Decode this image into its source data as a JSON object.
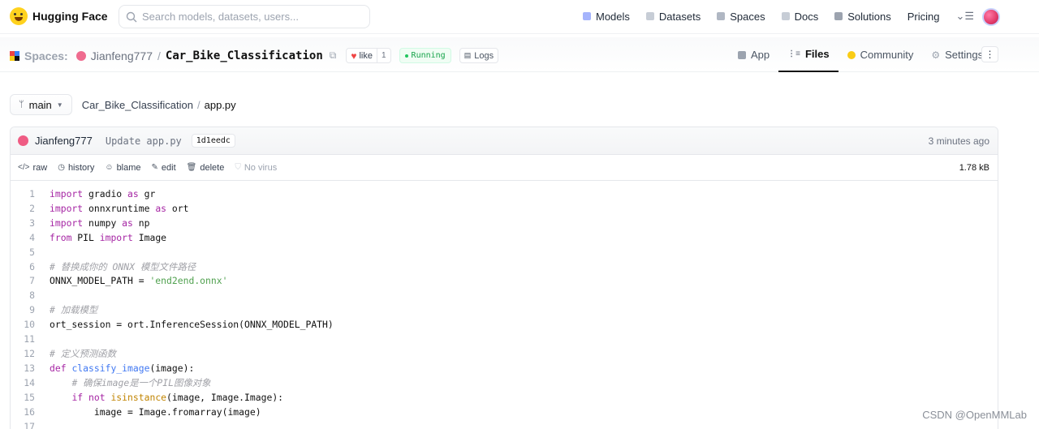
{
  "brand": {
    "name": "Hugging Face"
  },
  "search": {
    "placeholder": "Search models, datasets, users..."
  },
  "nav": {
    "models": "Models",
    "datasets": "Datasets",
    "spaces": "Spaces",
    "docs": "Docs",
    "solutions": "Solutions",
    "pricing": "Pricing"
  },
  "space": {
    "section": "Spaces:",
    "owner": "Jianfeng777",
    "repo": "Car_Bike_Classification",
    "like_label": "like",
    "like_count": "1",
    "status": "Running",
    "logs_label": "Logs"
  },
  "tabs": {
    "app": "App",
    "files": "Files",
    "community": "Community",
    "settings": "Settings"
  },
  "branch": {
    "name": "main"
  },
  "path": {
    "repo": "Car_Bike_Classification",
    "sep": "/",
    "file": "app.py"
  },
  "commit": {
    "author": "Jianfeng777",
    "message": "Update app.py",
    "hash": "1d1eedc",
    "time": "3 minutes ago"
  },
  "file_actions": {
    "raw": "raw",
    "history": "history",
    "blame": "blame",
    "edit": "edit",
    "delete": "delete",
    "virus": "No virus",
    "size": "1.78 kB"
  },
  "code_lines": [
    {
      "n": "1",
      "html": "<span class=\"kw\">import</span> gradio <span class=\"kw\">as</span> gr"
    },
    {
      "n": "2",
      "html": "<span class=\"kw\">import</span> onnxruntime <span class=\"kw\">as</span> ort"
    },
    {
      "n": "3",
      "html": "<span class=\"kw\">import</span> numpy <span class=\"kw\">as</span> np"
    },
    {
      "n": "4",
      "html": "<span class=\"kw\">from</span> PIL <span class=\"kw\">import</span> Image"
    },
    {
      "n": "5",
      "html": ""
    },
    {
      "n": "6",
      "html": "<span class=\"cm\"># 替换成你的 ONNX 模型文件路径</span>"
    },
    {
      "n": "7",
      "html": "ONNX_MODEL_PATH = <span class=\"str\">'end2end.onnx'</span>"
    },
    {
      "n": "8",
      "html": ""
    },
    {
      "n": "9",
      "html": "<span class=\"cm\"># 加载模型</span>"
    },
    {
      "n": "10",
      "html": "ort_session = ort.InferenceSession(ONNX_MODEL_PATH)"
    },
    {
      "n": "11",
      "html": ""
    },
    {
      "n": "12",
      "html": "<span class=\"cm\"># 定义预测函数</span>"
    },
    {
      "n": "13",
      "html": "<span class=\"kw\">def</span> <span class=\"fn\">classify_image</span>(image):"
    },
    {
      "n": "14",
      "html": "    <span class=\"cm\"># 确保image是一个PIL图像对象</span>"
    },
    {
      "n": "15",
      "html": "    <span class=\"kw\">if</span> <span class=\"kw\">not</span> <span class=\"bi\">isinstance</span>(image, Image.Image):"
    },
    {
      "n": "16",
      "html": "        image = Image.fromarray(image)"
    },
    {
      "n": "17",
      "html": ""
    }
  ],
  "watermark": "CSDN @OpenMMLab",
  "colors": {
    "accent": "#ffd21e",
    "running": "#16a34a",
    "keyword": "#a626a4",
    "string": "#50a14f",
    "function": "#4078f2"
  }
}
